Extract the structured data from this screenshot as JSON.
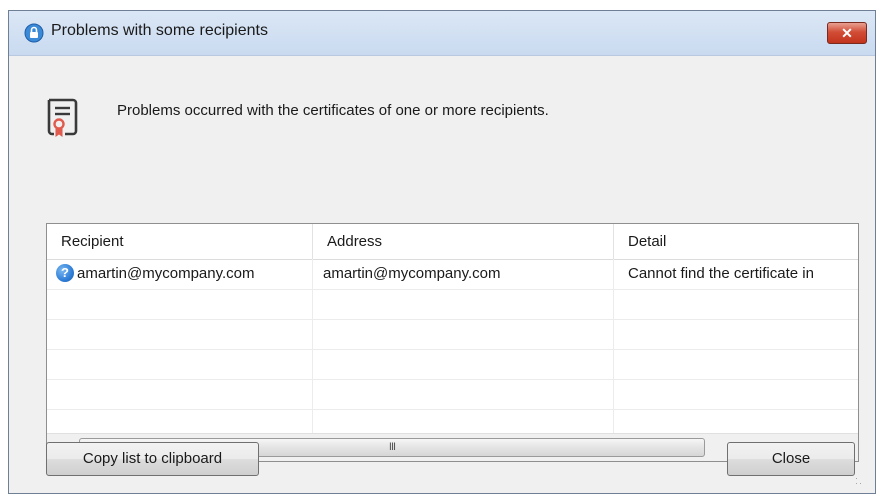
{
  "window": {
    "title": "Problems with some recipients",
    "close_glyph": "✕"
  },
  "message": {
    "text": "Problems occurred with the certificates of one or more recipients.",
    "icon": "certificate-document-icon"
  },
  "table": {
    "columns": [
      "Recipient",
      "Address",
      "Detail"
    ],
    "rows": [
      {
        "status_icon": "question-icon",
        "status_glyph": "?",
        "recipient": "amartin@mycompany.com",
        "address": "amartin@mycompany.com",
        "detail": "Cannot find the certificate in"
      }
    ],
    "scrollbar": {
      "left_arrow": "◀",
      "right_arrow": "▶",
      "grip": "III"
    }
  },
  "buttons": {
    "copy_label": "Copy list to clipboard",
    "close_label": "Close"
  },
  "colors": {
    "title_bar": "#c9daf0",
    "close_button": "#c2331c",
    "dialog_background": "#f0f0f0",
    "question_icon": "#2f7ed8",
    "certificate_icon_accent": "#e05a4e"
  }
}
